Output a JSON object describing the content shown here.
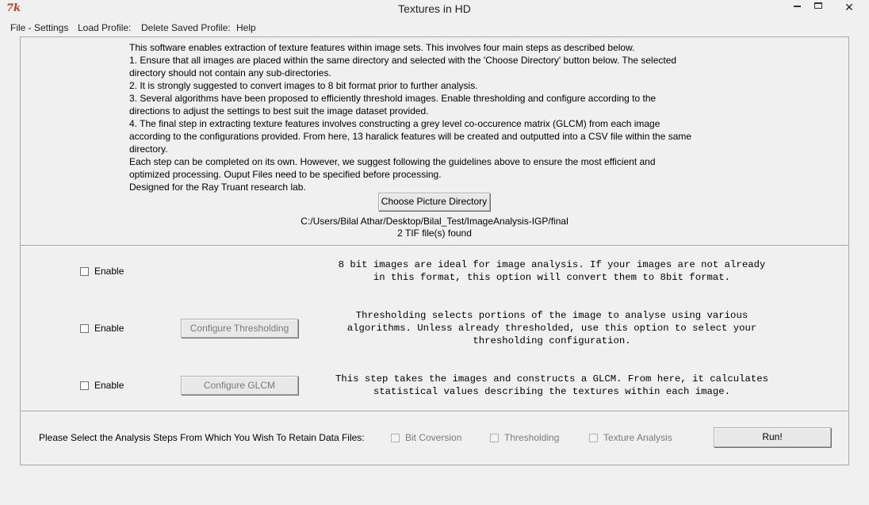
{
  "window": {
    "title": "Textures in HD",
    "icon_glyph": "7k"
  },
  "menu": [
    "File - Settings",
    "Load Profile:",
    "Delete Saved Profile:",
    "Help"
  ],
  "intro": [
    "This software enables extraction of texture features within image sets. This involves four main steps as described below.",
    "1. Ensure that all images are placed within the same directory and selected with the 'Choose Directory' button below. The selected",
    "directory should not contain any sub-directories.",
    "2. It is strongly suggested to convert images to 8 bit format prior to further analysis.",
    "3. Several algorithms have been proposed to efficiently threshold images. Enable thresholding and configure according to the",
    "directions to adjust the settings to best suit the image dataset provided.",
    "4. The final step in extracting texture features involves constructing a grey level co-occurence matrix (GLCM) from each image",
    "according to the configurations provided. From here, 13 haralick features will be created and outputted into a CSV file within the same",
    "directory.",
    "Each step can be completed on its own. However, we suggest following the guidelines above to ensure the most efficient and",
    "optimized processing. Ouput Files need to be specified before processing.",
    "Designed for the Ray Truant research lab."
  ],
  "directory": {
    "button_label": "Choose Picture Directory",
    "path": "C:/Users/Bilal Athar/Desktop/Bilal_Test/ImageAnalysis-IGP/final",
    "file_count": "2 TIF file(s) found"
  },
  "steps": {
    "bit_conversion": {
      "enable_label": "Enable",
      "enabled": false,
      "description": "8 bit images are ideal for image analysis. If your images are not already\nin this format, this option will convert them to 8bit format."
    },
    "thresholding": {
      "enable_label": "Enable",
      "enabled": false,
      "button_label": "Configure Thresholding",
      "description": "Thresholding selects portions of the image to analyse using various\nalgorithms. Unless already thresholded, use this option to select your\nthresholding configuration."
    },
    "glcm": {
      "enable_label": "Enable",
      "enabled": false,
      "button_label": "Configure GLCM",
      "description": "This step takes the images and constructs a GLCM. From here, it calculates\nstatistical values describing the textures within each image."
    }
  },
  "retain": {
    "label": "Please Select the Analysis Steps From Which You Wish To Retain Data Files:",
    "options": [
      "Bit Coversion",
      "Thresholding",
      "Texture Analysis"
    ],
    "run_label": "Run!"
  },
  "icons": {
    "app": "tk-feather-icon",
    "minimize": "minimize-icon",
    "maximize": "maximize-icon",
    "close": "close-icon"
  }
}
